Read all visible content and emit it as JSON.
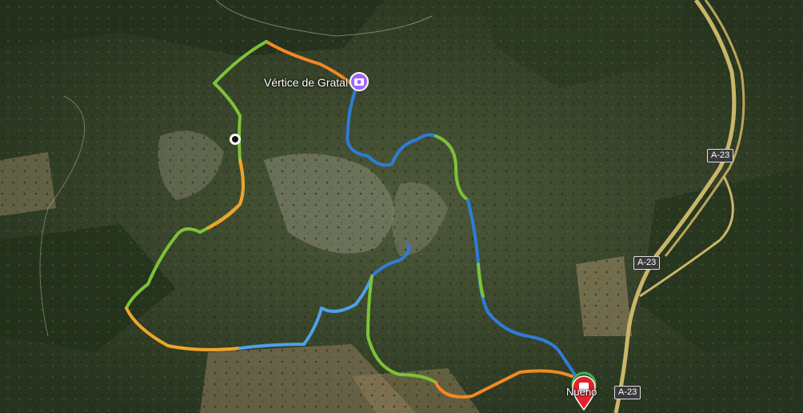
{
  "map": {
    "type": "satellite",
    "poi": {
      "label": "Vértice de Gratal",
      "icon": "camera-icon",
      "color": "#a066ff"
    },
    "town": {
      "label": "Nueno"
    },
    "roads": [
      {
        "label": "A-23"
      },
      {
        "label": "A-23"
      },
      {
        "label": "A-23"
      }
    ],
    "route_colors": {
      "slow": "#2f7bd8",
      "medium": "#7cc238",
      "fast": "#f08a24"
    },
    "end_marker": {
      "icon": "stop-pin-icon",
      "color": "#e3232c"
    },
    "waypoint": {
      "icon": "waypoint-dot-icon"
    }
  }
}
